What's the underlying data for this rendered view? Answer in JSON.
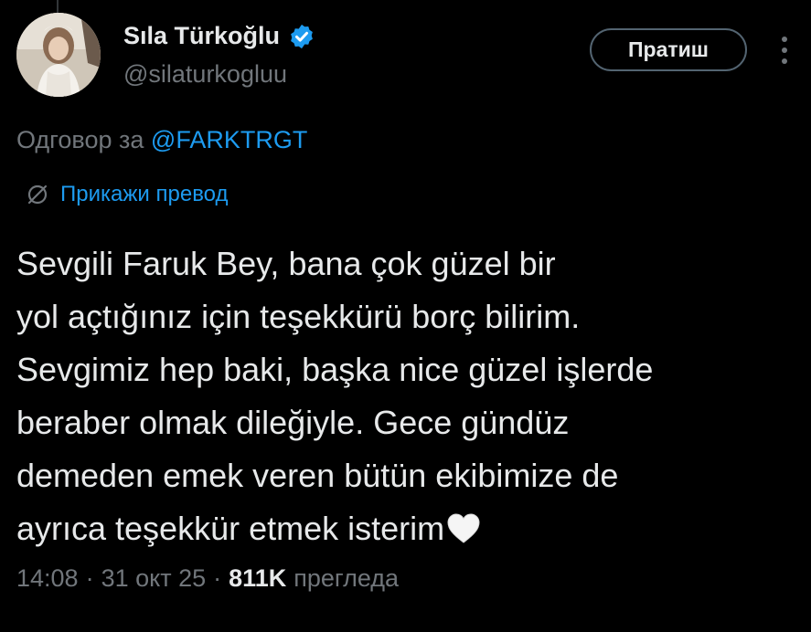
{
  "author": {
    "display_name": "Sıla Türkoğlu",
    "handle": "@silaturkogluu",
    "verified": true
  },
  "actions": {
    "follow_label": "Пратиш",
    "more_icon": "more-vertical-icon"
  },
  "reply": {
    "prefix": "Одговор за",
    "mention": "@FARKTRGT"
  },
  "translate": {
    "icon": "globe-icon",
    "label": "Прикажи превод"
  },
  "tweet": {
    "lines": [
      "Sevgili Faruk Bey, bana çok güzel bir",
      "yol açtığınız için teşekkürü borç bilirim.",
      "Sevgimiz hep baki, başka nice güzel işlerde",
      "beraber olmak dileğiyle. Gece gündüz",
      "demeden emek veren bütün ekibimize de",
      "ayrıca teşekkür etmek isterim"
    ],
    "trailing_emoji": "white-heart-icon"
  },
  "meta": {
    "time": "14:08",
    "separator": "·",
    "date": "31 окт 25",
    "views_count": "811K",
    "views_label": "прегледа"
  },
  "colors": {
    "background": "#000000",
    "text_primary": "#e7e9ea",
    "text_secondary": "#71767b",
    "accent": "#1d9bf0",
    "button_border": "#536471"
  }
}
